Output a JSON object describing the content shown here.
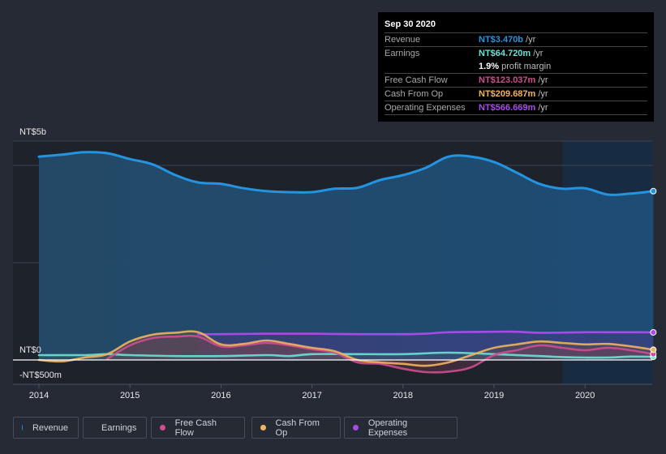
{
  "tooltip": {
    "date": "Sep 30 2020",
    "rows": [
      {
        "label": "Revenue",
        "value": "NT$3.470b",
        "unit": "/yr",
        "color": "#2394df"
      },
      {
        "label": "Earnings",
        "value": "NT$64.720m",
        "unit": "/yr",
        "color": "#6ce1d5"
      },
      {
        "label": "",
        "value": "1.9%",
        "unit": "profit margin",
        "color": "#ffffff"
      },
      {
        "label": "Free Cash Flow",
        "value": "NT$123.037m",
        "unit": "/yr",
        "color": "#cf4e8f"
      },
      {
        "label": "Cash From Op",
        "value": "NT$209.687m",
        "unit": "/yr",
        "color": "#f0b35f"
      },
      {
        "label": "Operating Expenses",
        "value": "NT$566.669m",
        "unit": "/yr",
        "color": "#a74be8"
      }
    ]
  },
  "legend": [
    {
      "label": "Revenue",
      "color": "#2394df"
    },
    {
      "label": "Earnings",
      "color": "#6ce1d5"
    },
    {
      "label": "Free Cash Flow",
      "color": "#cf4e8f"
    },
    {
      "label": "Cash From Op",
      "color": "#f0b35f"
    },
    {
      "label": "Operating Expenses",
      "color": "#a74be8"
    }
  ],
  "chart_data": {
    "type": "line",
    "title": "",
    "xlabel": "",
    "ylabel": "",
    "y_tick_labels": [
      "NT$5b",
      "NT$0",
      "-NT$500m"
    ],
    "x_tick_labels": [
      "2014",
      "2015",
      "2016",
      "2017",
      "2018",
      "2019",
      "2020"
    ],
    "x_ticks": [
      2014,
      2015,
      2016,
      2017,
      2018,
      2019,
      2020
    ],
    "xlim": [
      2013.7,
      2020.75
    ],
    "ylim": [
      -0.5,
      4.5
    ],
    "units": "NT$ billions",
    "grid": true,
    "legend_position": "bottom",
    "highlight_start": 2019.75,
    "series": [
      {
        "name": "Revenue",
        "color": "#2394df",
        "x": [
          2014,
          2014.25,
          2014.5,
          2014.75,
          2015,
          2015.25,
          2015.5,
          2015.75,
          2016,
          2016.25,
          2016.5,
          2016.75,
          2017,
          2017.25,
          2017.5,
          2017.75,
          2018,
          2018.25,
          2018.5,
          2018.75,
          2019,
          2019.25,
          2019.5,
          2019.75,
          2020,
          2020.25,
          2020.5,
          2020.75
        ],
        "values": [
          4.18,
          4.22,
          4.27,
          4.25,
          4.13,
          4.02,
          3.8,
          3.65,
          3.62,
          3.53,
          3.47,
          3.45,
          3.45,
          3.52,
          3.54,
          3.7,
          3.8,
          3.95,
          4.18,
          4.18,
          4.07,
          3.85,
          3.62,
          3.52,
          3.53,
          3.4,
          3.42,
          3.47
        ]
      },
      {
        "name": "Earnings",
        "color": "#6ce1d5",
        "x": [
          2014,
          2014.5,
          2014.75,
          2015,
          2015.5,
          2016,
          2016.5,
          2016.75,
          2017,
          2017.5,
          2018,
          2018.5,
          2019,
          2019.5,
          2019.75,
          2020,
          2020.25,
          2020.5,
          2020.75
        ],
        "values": [
          0.1,
          0.1,
          0.12,
          0.1,
          0.08,
          0.08,
          0.1,
          0.08,
          0.12,
          0.12,
          0.12,
          0.15,
          0.12,
          0.08,
          0.06,
          0.05,
          0.05,
          0.07,
          0.065
        ]
      },
      {
        "name": "Free Cash Flow",
        "color": "#cf4e8f",
        "x": [
          2014.75,
          2015,
          2015.25,
          2015.5,
          2015.75,
          2016,
          2016.25,
          2016.5,
          2016.75,
          2017,
          2017.25,
          2017.5,
          2017.75,
          2018,
          2018.25,
          2018.5,
          2018.75,
          2019,
          2019.25,
          2019.5,
          2019.75,
          2020,
          2020.25,
          2020.5,
          2020.75
        ],
        "values": [
          0.02,
          0.3,
          0.45,
          0.48,
          0.48,
          0.28,
          0.3,
          0.35,
          0.3,
          0.22,
          0.15,
          -0.05,
          -0.08,
          -0.18,
          -0.25,
          -0.24,
          -0.15,
          0.1,
          0.2,
          0.3,
          0.25,
          0.2,
          0.25,
          0.2,
          0.12
        ]
      },
      {
        "name": "Cash From Op",
        "color": "#f0b35f",
        "x": [
          2014,
          2014.25,
          2014.5,
          2014.75,
          2015,
          2015.25,
          2015.5,
          2015.75,
          2016,
          2016.25,
          2016.5,
          2016.75,
          2017,
          2017.25,
          2017.5,
          2017.75,
          2018,
          2018.25,
          2018.5,
          2018.75,
          2019,
          2019.25,
          2019.5,
          2019.75,
          2020,
          2020.25,
          2020.5,
          2020.75
        ],
        "values": [
          0.0,
          -0.03,
          0.05,
          0.12,
          0.38,
          0.52,
          0.56,
          0.57,
          0.32,
          0.33,
          0.4,
          0.33,
          0.25,
          0.18,
          0.0,
          -0.05,
          -0.08,
          -0.12,
          -0.05,
          0.1,
          0.25,
          0.32,
          0.38,
          0.35,
          0.32,
          0.33,
          0.28,
          0.21
        ]
      },
      {
        "name": "Operating Expenses",
        "color": "#a74be8",
        "x": [
          2015.75,
          2016,
          2016.5,
          2017,
          2017.5,
          2018,
          2018.25,
          2018.5,
          2019,
          2019.25,
          2019.5,
          2020,
          2020.25,
          2020.5,
          2020.75
        ],
        "values": [
          0.53,
          0.53,
          0.54,
          0.54,
          0.53,
          0.53,
          0.54,
          0.57,
          0.58,
          0.58,
          0.56,
          0.57,
          0.57,
          0.57,
          0.567
        ]
      }
    ]
  }
}
